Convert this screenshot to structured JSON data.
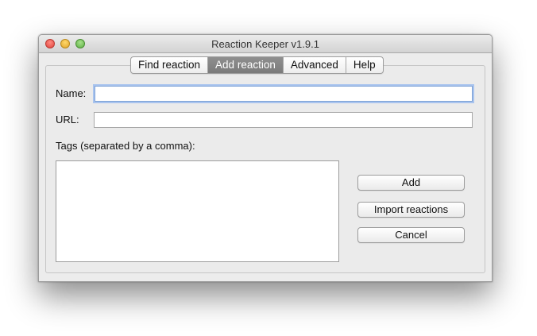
{
  "window": {
    "title": "Reaction Keeper v1.9.1"
  },
  "tabs": [
    {
      "label": "Find reaction",
      "active": false
    },
    {
      "label": "Add reaction",
      "active": true
    },
    {
      "label": "Advanced",
      "active": false
    },
    {
      "label": "Help",
      "active": false
    }
  ],
  "form": {
    "name_label": "Name:",
    "name_value": "",
    "url_label": "URL:",
    "url_value": "",
    "tags_label": "Tags (separated by a comma):",
    "tags_value": ""
  },
  "buttons": {
    "add": "Add",
    "import": "Import reactions",
    "cancel": "Cancel"
  },
  "traffic_lights": {
    "close_color": "#e0443e",
    "minimize_color": "#e1a52c",
    "zoom_color": "#5fb146"
  }
}
